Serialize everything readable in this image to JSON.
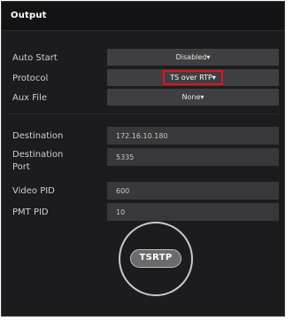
{
  "panel": {
    "title": "Output"
  },
  "fields": {
    "auto_start": {
      "label": "Auto Start",
      "value": "Disabled"
    },
    "protocol": {
      "label": "Protocol",
      "value": "TS over RTP"
    },
    "aux_file": {
      "label": "Aux File",
      "value": "None"
    },
    "destination": {
      "label": "Destination",
      "value": "172.16.10.180"
    },
    "destination_port": {
      "label_line1": "Destination",
      "label_line2": "Port",
      "value": "5335"
    },
    "video_pid": {
      "label": "Video PID",
      "value": "600"
    },
    "pmt_pid": {
      "label": "PMT PID",
      "value": "10"
    }
  },
  "dropdown_caret": "▾",
  "badge": {
    "label": "TSRTP"
  },
  "colors": {
    "panel_bg": "#1c1c1e",
    "control_bg": "#3f3f41",
    "highlight": "#e0131c"
  }
}
